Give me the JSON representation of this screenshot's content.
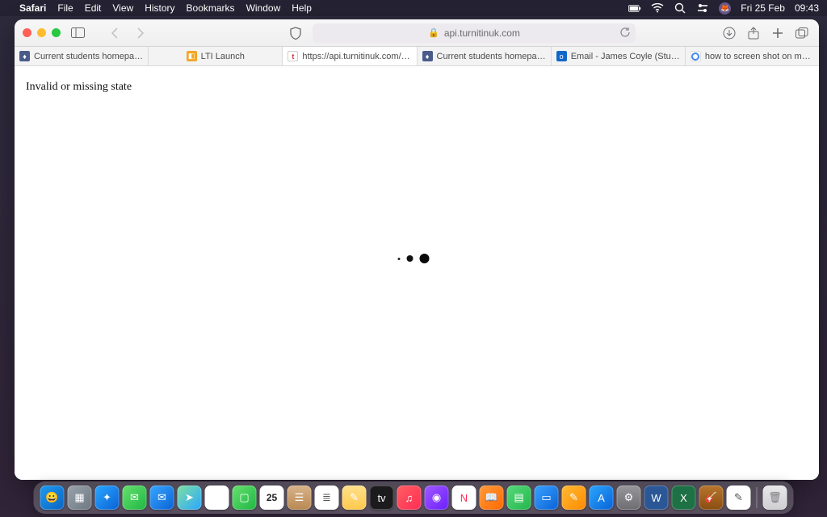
{
  "menubar": {
    "app": "Safari",
    "items": [
      "File",
      "Edit",
      "View",
      "History",
      "Bookmarks",
      "Window",
      "Help"
    ],
    "date": "Fri 25 Feb",
    "time": "09:43"
  },
  "toolbar": {},
  "address": {
    "url": "api.turnitinuk.com"
  },
  "tabs": [
    {
      "label": "Current students homepage |…",
      "favicon": "bb"
    },
    {
      "label": "LTI Launch",
      "favicon": "lti"
    },
    {
      "label": "https://api.turnitinuk.com/api/lti…",
      "favicon": "turnitin",
      "active": true
    },
    {
      "label": "Current students homepage |…",
      "favicon": "bb"
    },
    {
      "label": "Email - James Coyle (Student)…",
      "favicon": "outlook"
    },
    {
      "label": "how to screen shot on mac - G…",
      "favicon": "google"
    }
  ],
  "page": {
    "message": "Invalid or missing state"
  },
  "dock": [
    {
      "name": "finder",
      "bg": "linear-gradient(135deg,#1e9bf0,#0a64c2)",
      "glyph": "😀"
    },
    {
      "name": "launchpad",
      "bg": "linear-gradient(135deg,#9aa3ad,#6e7881)",
      "glyph": "▦"
    },
    {
      "name": "safari",
      "bg": "linear-gradient(135deg,#2aa7ff,#0a62d6)",
      "glyph": "✦"
    },
    {
      "name": "messages",
      "bg": "linear-gradient(135deg,#66e06e,#1fb744)",
      "glyph": "✉"
    },
    {
      "name": "mail",
      "bg": "linear-gradient(135deg,#39a8ff,#0a62d6)",
      "glyph": "✉"
    },
    {
      "name": "maps",
      "bg": "linear-gradient(135deg,#7ee0a2,#2aa7ff)",
      "glyph": "➤"
    },
    {
      "name": "photos",
      "bg": "#ffffff",
      "glyph": "✿"
    },
    {
      "name": "facetime",
      "bg": "linear-gradient(135deg,#66e06e,#1fb744)",
      "glyph": "▢"
    },
    {
      "name": "calendar",
      "bg": "#ffffff",
      "glyph": "25",
      "color": "#d0323a"
    },
    {
      "name": "contacts",
      "bg": "linear-gradient(180deg,#d8b38a,#b98953)",
      "glyph": "☰"
    },
    {
      "name": "reminders",
      "bg": "#ffffff",
      "glyph": "≣",
      "color": "#555"
    },
    {
      "name": "notes",
      "bg": "linear-gradient(180deg,#ffe08a,#ffc94d)",
      "glyph": "✎"
    },
    {
      "name": "tv",
      "bg": "#1b1b1d",
      "glyph": "tv"
    },
    {
      "name": "music",
      "bg": "linear-gradient(135deg,#ff5e62,#ff2d55)",
      "glyph": "♫"
    },
    {
      "name": "podcasts",
      "bg": "linear-gradient(135deg,#a259ff,#6b1fff)",
      "glyph": "◉"
    },
    {
      "name": "news",
      "bg": "#ffffff",
      "glyph": "N",
      "color": "#ff2d55"
    },
    {
      "name": "books",
      "bg": "linear-gradient(135deg,#ff9a3c,#ff6a00)",
      "glyph": "📖"
    },
    {
      "name": "numbers",
      "bg": "linear-gradient(135deg,#57d97a,#23b84d)",
      "glyph": "▤"
    },
    {
      "name": "keynote",
      "bg": "linear-gradient(135deg,#3aa2ff,#0a62d6)",
      "glyph": "▭"
    },
    {
      "name": "pages",
      "bg": "linear-gradient(135deg,#ffbb33,#ff8a00)",
      "glyph": "✎"
    },
    {
      "name": "appstore",
      "bg": "linear-gradient(135deg,#2aa7ff,#0a62d6)",
      "glyph": "A"
    },
    {
      "name": "settings",
      "bg": "linear-gradient(180deg,#97979b,#6e6e72)",
      "glyph": "⚙"
    },
    {
      "name": "word",
      "bg": "#2b5797",
      "glyph": "W"
    },
    {
      "name": "excel",
      "bg": "#1e7145",
      "glyph": "X"
    },
    {
      "name": "garageband",
      "bg": "linear-gradient(180deg,#b8752c,#8a4e12)",
      "glyph": "🎸"
    },
    {
      "name": "textedit",
      "bg": "#ffffff",
      "glyph": "✎",
      "color": "#555"
    },
    {
      "name": "trash",
      "bg": "trash",
      "glyph": "🗑"
    }
  ]
}
